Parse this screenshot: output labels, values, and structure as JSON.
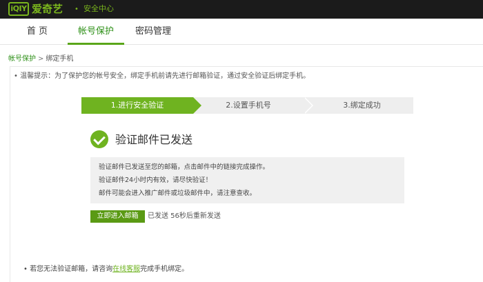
{
  "header": {
    "logo_mark": "iQIY",
    "logo_text": "爱奇艺",
    "separator": "•",
    "section_title": "安全中心"
  },
  "nav": {
    "tabs": [
      {
        "label": "首 页",
        "active": false
      },
      {
        "label": "帐号保护",
        "active": true
      },
      {
        "label": "密码管理",
        "active": false
      }
    ]
  },
  "breadcrumb": {
    "parent": "帐号保护",
    "separator": ">",
    "current": "绑定手机"
  },
  "tip": "• 温馨提示：为了保护您的帐号安全，绑定手机前请先进行邮箱验证，通过安全验证后绑定手机。",
  "steps": [
    {
      "label": "1.进行安全验证",
      "active": true
    },
    {
      "label": "2.设置手机号",
      "active": false
    },
    {
      "label": "3.绑定成功",
      "active": false
    }
  ],
  "success": {
    "icon": "check-circle-icon",
    "title": "验证邮件已发送"
  },
  "info_lines": [
    "验证邮件已发送至您的邮箱，点击邮件中的链接完成操作。",
    "验证邮件24小时内有效，请尽快验证！",
    "邮件可能会进入推广邮件或垃圾邮件中，请注意查收。"
  ],
  "action": {
    "enter_mailbox_label": "立即进入邮箱",
    "resend_status": "已发送 56秒后重新发送"
  },
  "footer_tip": {
    "prefix": "• 若您无法验证邮箱，请咨询",
    "link": "在线客服",
    "suffix": "完成手机绑定。"
  },
  "colors": {
    "accent": "#6fb320",
    "topbar": "#1b1b1b",
    "button": "#5a9a14"
  }
}
